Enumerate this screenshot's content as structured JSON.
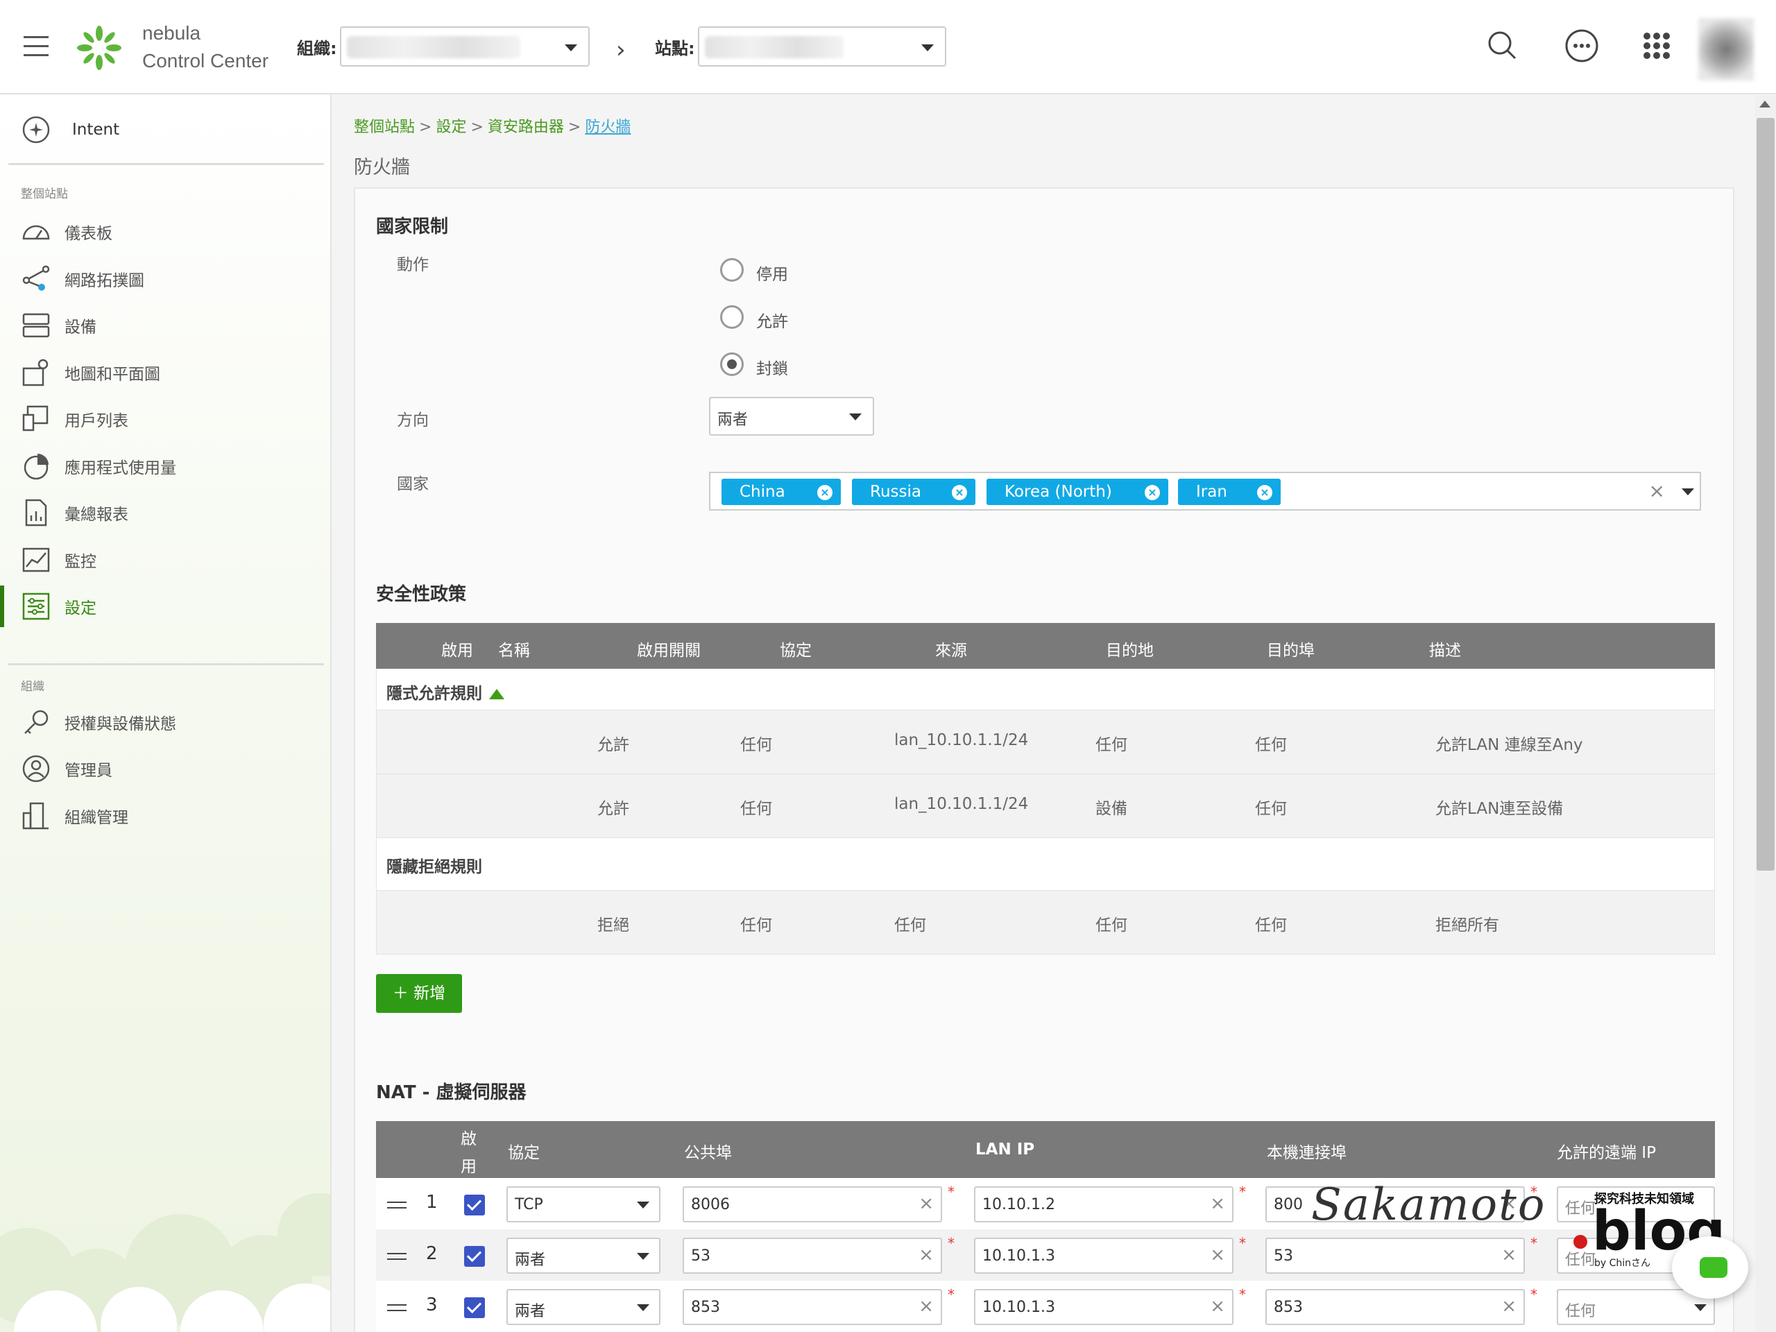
{
  "header": {
    "logo_line1": "nebula",
    "logo_line2": "Control Center",
    "org_label": "組織:",
    "site_label": "站點:"
  },
  "sidebar": {
    "intent": "Intent",
    "section_site": "整個站點",
    "items_site": [
      {
        "label": "儀表板",
        "icon": "dashboard-icon"
      },
      {
        "label": "網路拓撲圖",
        "icon": "topology-icon"
      },
      {
        "label": "設備",
        "icon": "devices-icon"
      },
      {
        "label": "地圖和平面圖",
        "icon": "map-icon"
      },
      {
        "label": "用戶列表",
        "icon": "clients-icon"
      },
      {
        "label": "應用程式使用量",
        "icon": "pie-icon"
      },
      {
        "label": "彙總報表",
        "icon": "report-icon"
      },
      {
        "label": "監控",
        "icon": "monitor-icon"
      },
      {
        "label": "設定",
        "icon": "settings-icon"
      }
    ],
    "section_org": "組織",
    "items_org": [
      {
        "label": "授權與設備狀態",
        "icon": "license-icon"
      },
      {
        "label": "管理員",
        "icon": "admin-icon"
      },
      {
        "label": "組織管理",
        "icon": "org-icon"
      }
    ]
  },
  "breadcrumb": {
    "b1": "整個站點",
    "b2": "設定",
    "b3": "資安路由器",
    "current": "防火牆",
    "sep": ">"
  },
  "page_title": "防火牆",
  "country_restriction": {
    "title": "國家限制",
    "action_label": "動作",
    "options": [
      "停用",
      "允許",
      "封鎖"
    ],
    "selected": "封鎖",
    "direction_label": "方向",
    "direction_value": "兩者",
    "country_label": "國家",
    "countries": [
      "China",
      "Russia",
      "Korea (North)",
      "Iran"
    ]
  },
  "security_policy": {
    "title": "安全性政策",
    "columns": [
      "啟用",
      "名稱",
      "啟用開關",
      "協定",
      "來源",
      "目的地",
      "目的埠",
      "描述"
    ],
    "implicit_allow_title": "隱式允許規則",
    "allow_rows": [
      {
        "action": "允許",
        "protocol": "任何",
        "source": "lan_10.10.1.1/24",
        "dest": "任何",
        "port": "任何",
        "desc": "允許LAN 連線至Any"
      },
      {
        "action": "允許",
        "protocol": "任何",
        "source": "lan_10.10.1.1/24",
        "dest": "設備",
        "port": "任何",
        "desc": "允許LAN連至設備"
      }
    ],
    "implicit_deny_title": "隱藏拒絕規則",
    "deny_rows": [
      {
        "action": "拒絕",
        "protocol": "任何",
        "source": "任何",
        "dest": "任何",
        "port": "任何",
        "desc": "拒絕所有"
      }
    ],
    "add_label": "＋ 新增"
  },
  "nat": {
    "title": "NAT - 虛擬伺服器",
    "columns": {
      "enable1": "啟",
      "enable2": "用",
      "protocol": "協定",
      "public_port": "公共埠",
      "lan_ip": "LAN IP",
      "local_port": "本機連接埠",
      "remote_ip": "允許的遠端 IP"
    },
    "rows": [
      {
        "n": "1",
        "protocol": "TCP",
        "public_port": "8006",
        "lan_ip": "10.10.1.2",
        "local_port": "800",
        "remote": "任何"
      },
      {
        "n": "2",
        "protocol": "兩者",
        "public_port": "53",
        "lan_ip": "10.10.1.3",
        "local_port": "53",
        "remote": "任何"
      },
      {
        "n": "3",
        "protocol": "兩者",
        "public_port": "853",
        "lan_ip": "10.10.1.3",
        "local_port": "853",
        "remote": "任何"
      }
    ]
  },
  "watermark": {
    "script": "Sakamoto",
    "blog": "blog",
    "sub": "探究科技未知領域",
    "by": "by Chinさん"
  },
  "colors": {
    "accent_green": "#2f9a16",
    "tag_blue": "#11a9e5",
    "header_grey": "#7a7a7a"
  }
}
